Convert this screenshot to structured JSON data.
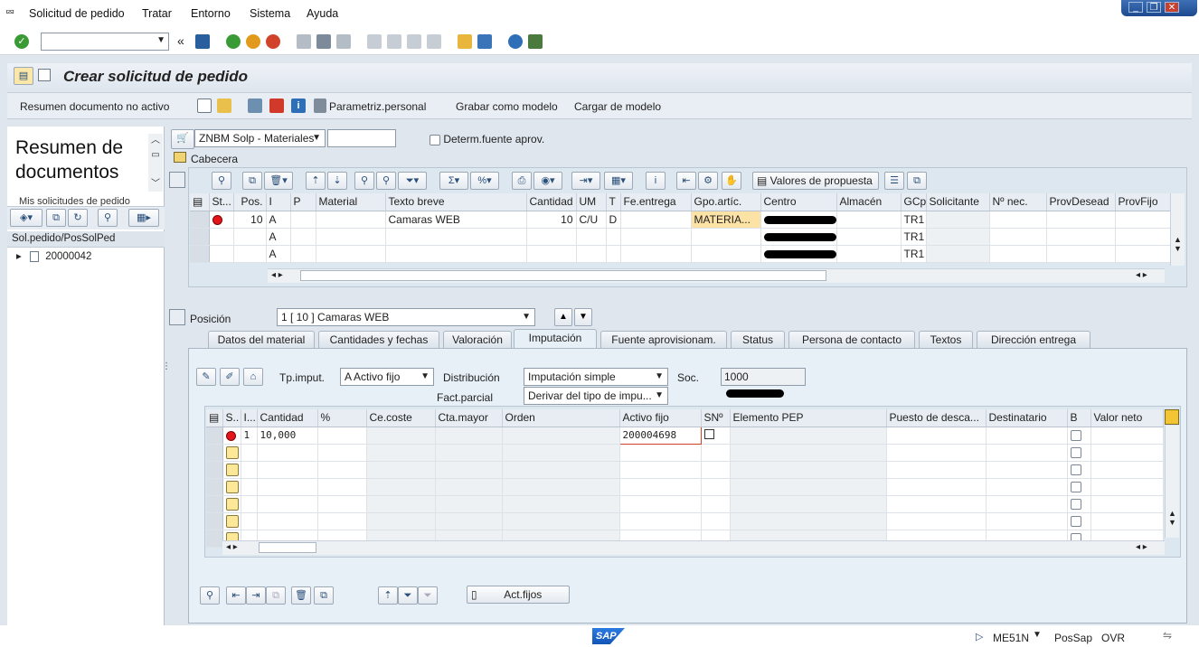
{
  "menu": [
    "Solicitud de pedido",
    "Tratar",
    "Entorno",
    "Sistema",
    "Ayuda"
  ],
  "title": "Crear solicitud de pedido",
  "app_toolbar": {
    "doc_summary": "Resumen documento no activo",
    "personal_settings": "Parametriz.personal",
    "save_as_template": "Grabar como modelo",
    "load_template": "Cargar de modelo"
  },
  "left_pane": {
    "title_line1": "Resumen de",
    "title_line2": "documentos",
    "subtitle": "Mis solicitudes de pedido",
    "column_header": "Sol.pedido/PosSolPed",
    "document": "20000042"
  },
  "header": {
    "doc_type": "ZNBM Solp - Materiales",
    "doc_number": "",
    "determ_source": "Determ.fuente aprov.",
    "cabecera": "Cabecera",
    "valores_propuesta": "Valores de propuesta"
  },
  "items_table": {
    "columns": [
      "St...",
      "Pos.",
      "I",
      "P",
      "Material",
      "Texto breve",
      "Cantidad",
      "UM",
      "T",
      "Fe.entrega",
      "Gpo.artíc.",
      "Centro",
      "Almacén",
      "GCp",
      "Solicitante",
      "Nº nec.",
      "ProvDesead",
      "ProvFijo"
    ],
    "rows": [
      {
        "pos": "10",
        "i": "A",
        "texto": "Camaras WEB",
        "cantidad": "10",
        "um": "C/U",
        "t": "D",
        "gpo": "MATERIA...",
        "gcp": "TR1"
      },
      {
        "pos": "",
        "i": "A",
        "texto": "",
        "cantidad": "",
        "um": "",
        "t": "",
        "gpo": "",
        "gcp": "TR1"
      },
      {
        "pos": "",
        "i": "A",
        "texto": "",
        "cantidad": "",
        "um": "",
        "t": "",
        "gpo": "",
        "gcp": "TR1"
      }
    ]
  },
  "position": {
    "label": "Posición",
    "value": "1 [ 10 ] Camaras WEB"
  },
  "tabs": [
    "Datos del material",
    "Cantidades y fechas",
    "Valoración",
    "Imputación",
    "Fuente aprovisionam.",
    "Status",
    "Persona de contacto",
    "Textos",
    "Dirección entrega"
  ],
  "active_tab": "Imputación",
  "imputacion": {
    "tp_imput_label": "Tp.imput.",
    "tp_imput_value": "A Activo fijo",
    "distribucion_label": "Distribución",
    "distribucion_value": "Imputación simple",
    "soc_label": "Soc.",
    "soc_value": "1000",
    "fact_parcial_label": "Fact.parcial",
    "fact_parcial_value": "Derivar del tipo de impu..."
  },
  "acct_table": {
    "columns": [
      "S..",
      "I...",
      "Cantidad",
      "%",
      "Ce.coste",
      "Cta.mayor",
      "Orden",
      "Activo fijo",
      "SNº",
      "Elemento PEP",
      "Puesto de desca...",
      "Destinatario",
      "B",
      "Valor neto"
    ],
    "row1": {
      "i": "1",
      "cantidad": "10,000",
      "activo": "200004698"
    }
  },
  "bottom_buttons": {
    "act_fijos": "Act.fijos"
  },
  "status_bar": {
    "transaction": "ME51N",
    "server": "PosSap",
    "mode": "OVR",
    "sap_logo": "SAP"
  }
}
